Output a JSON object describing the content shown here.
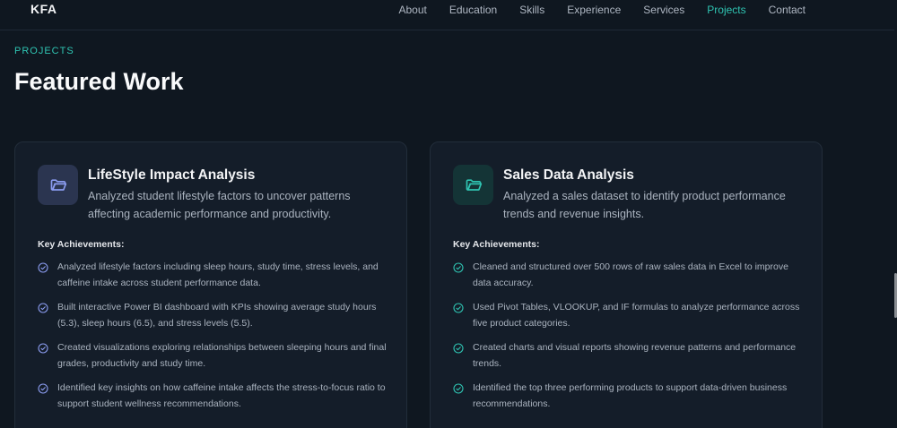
{
  "nav": {
    "logo": "KFA",
    "links": [
      "About",
      "Education",
      "Skills",
      "Experience",
      "Services",
      "Projects",
      "Contact"
    ],
    "active": "Projects"
  },
  "section": {
    "eyebrow": "PROJECTS",
    "title": "Featured Work"
  },
  "projects": [
    {
      "title": "LifeStyle Impact Analysis",
      "description": "Analyzed student lifestyle factors to uncover patterns affecting academic performance and productivity.",
      "achievements_label": "Key Achievements:",
      "icon": "folder-icon",
      "accent": "#8b9cf0",
      "achievements": [
        "Analyzed lifestyle factors including sleep hours, study time, stress levels, and caffeine intake across student performance data.",
        "Built interactive Power BI dashboard with KPIs showing average study hours (5.3), sleep hours (6.5), and stress levels (5.5).",
        "Created visualizations exploring relationships between sleeping hours and final grades, productivity and study time.",
        "Identified key insights on how caffeine intake affects the stress-to-focus ratio to support student wellness recommendations."
      ]
    },
    {
      "title": "Sales Data Analysis",
      "description": "Analyzed a sales dataset to identify product performance trends and revenue insights.",
      "achievements_label": "Key Achievements:",
      "icon": "folder-icon",
      "accent": "#2fc4b2",
      "achievements": [
        "Cleaned and structured over 500 rows of raw sales data in Excel to improve data accuracy.",
        "Used Pivot Tables, VLOOKUP, and IF formulas to analyze performance across five product categories.",
        "Created charts and visual reports showing revenue patterns and performance trends.",
        "Identified the top three performing products to support data-driven business recommendations."
      ]
    }
  ]
}
